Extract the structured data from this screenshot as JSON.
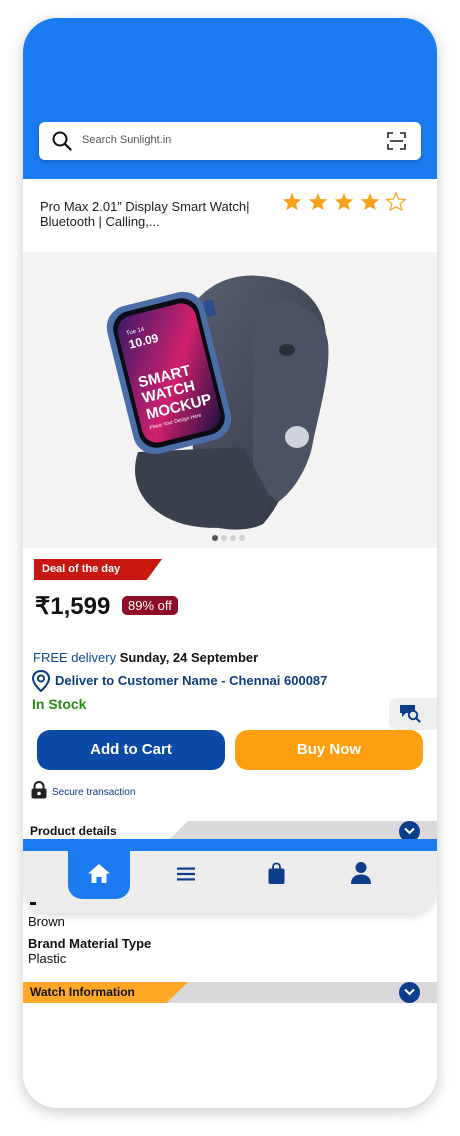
{
  "search": {
    "placeholder": "Search Sunlight.in"
  },
  "product": {
    "title": "Pro Max 2.01” Display Smart Watch| Bluetooth | Calling,...",
    "rating": 4,
    "rating_max": 5,
    "image_screen_lines": [
      "Tue 14",
      "10.09",
      "SMART",
      "WATCH",
      "MOCKUP",
      "Place Your Design Here"
    ],
    "carousel_count": 4,
    "carousel_active": 1
  },
  "deal": {
    "badge": "Deal of the day",
    "price": "₹1,599",
    "discount": "89% off"
  },
  "delivery": {
    "free_label": "FREE delivery",
    "date": "Sunday, 24 September",
    "deliver_to": "Deliver to Customer Name - Chennai  600087",
    "stock": "In Stock"
  },
  "actions": {
    "add_to_cart": "Add to Cart",
    "buy_now": "Buy Now"
  },
  "secure": {
    "label": "Secure transaction"
  },
  "sections": {
    "product_details": "Product details",
    "watch_information": "Watch Information"
  },
  "details": {
    "color_value": "Brown",
    "material_label": "Brand Material Type",
    "material_value": "Plastic"
  },
  "nav": {
    "items": [
      "home-icon",
      "menu-icon",
      "bag-icon",
      "user-icon"
    ],
    "active": "home"
  },
  "colors": {
    "brand_blue": "#1b7cf2",
    "dark_blue": "#0b4aa6",
    "orange": "#ff9e0f",
    "deal_red": "#c8170f",
    "star": "#f7a21b"
  }
}
